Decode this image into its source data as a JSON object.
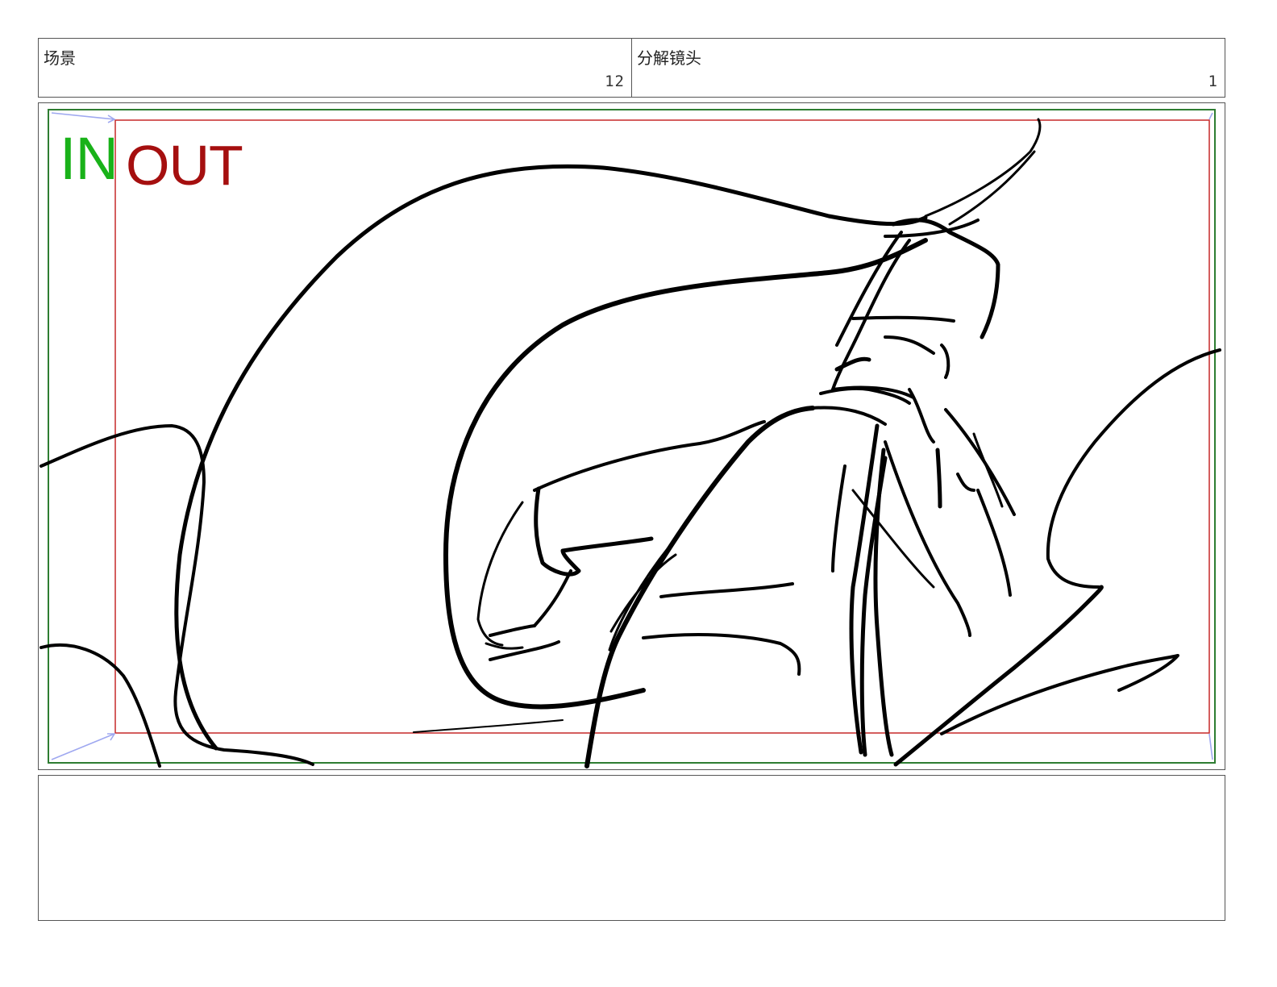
{
  "header": {
    "scene_label": "场景",
    "scene_number": "12",
    "shot_label": "分解镜头",
    "shot_number": "1"
  },
  "frame": {
    "in_label": "IN",
    "out_label": "OUT",
    "in_color": "#19b219",
    "out_color": "#a50f0f"
  },
  "notes": {
    "text": ""
  }
}
